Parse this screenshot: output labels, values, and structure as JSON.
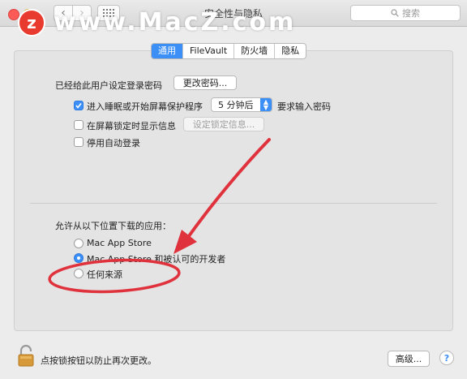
{
  "window": {
    "title": "安全性与隐私",
    "search_placeholder": "搜索"
  },
  "watermark": {
    "logo_letter": "z",
    "text": "www.MacZ.com",
    "logo_color": "#e83a2f"
  },
  "tabs": [
    {
      "label": "通用",
      "active": true
    },
    {
      "label": "FileVault",
      "active": false
    },
    {
      "label": "防火墙",
      "active": false
    },
    {
      "label": "隐私",
      "active": false
    }
  ],
  "general": {
    "password_label": "已经给此用户设定登录密码",
    "change_password_button": "更改密码...",
    "require_password": {
      "checked": true,
      "label_before": "进入睡眠或开始屏幕保护程序",
      "select_value": "5 分钟后",
      "label_after": "要求输入密码"
    },
    "lock_message": {
      "checked": false,
      "label": "在屏幕锁定时显示信息",
      "button": "设定锁定信息..."
    },
    "disable_auto_login": {
      "checked": false,
      "label": "停用自动登录"
    }
  },
  "download_apps": {
    "heading": "允许从以下位置下载的应用：",
    "options": [
      {
        "label": "Mac App Store",
        "selected": false
      },
      {
        "label": "Mac App Store 和被认可的开发者",
        "selected": true
      },
      {
        "label": "任何来源",
        "selected": false
      }
    ]
  },
  "footer": {
    "lock_text": "点按锁按钮以防止再次更改。",
    "advanced_button": "高级...",
    "help_label": "?"
  },
  "colors": {
    "accent": "#3b8ff7",
    "annotation": "#e0323c"
  }
}
